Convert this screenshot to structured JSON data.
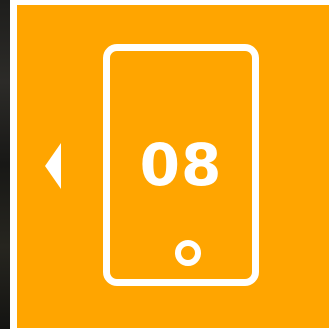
{
  "device": {
    "number": "08",
    "icon": "phone-icon"
  },
  "navigation": {
    "back_icon": "triangle-left-icon"
  },
  "colors": {
    "panel": "#FFA500",
    "foreground": "#FFFFFF"
  }
}
